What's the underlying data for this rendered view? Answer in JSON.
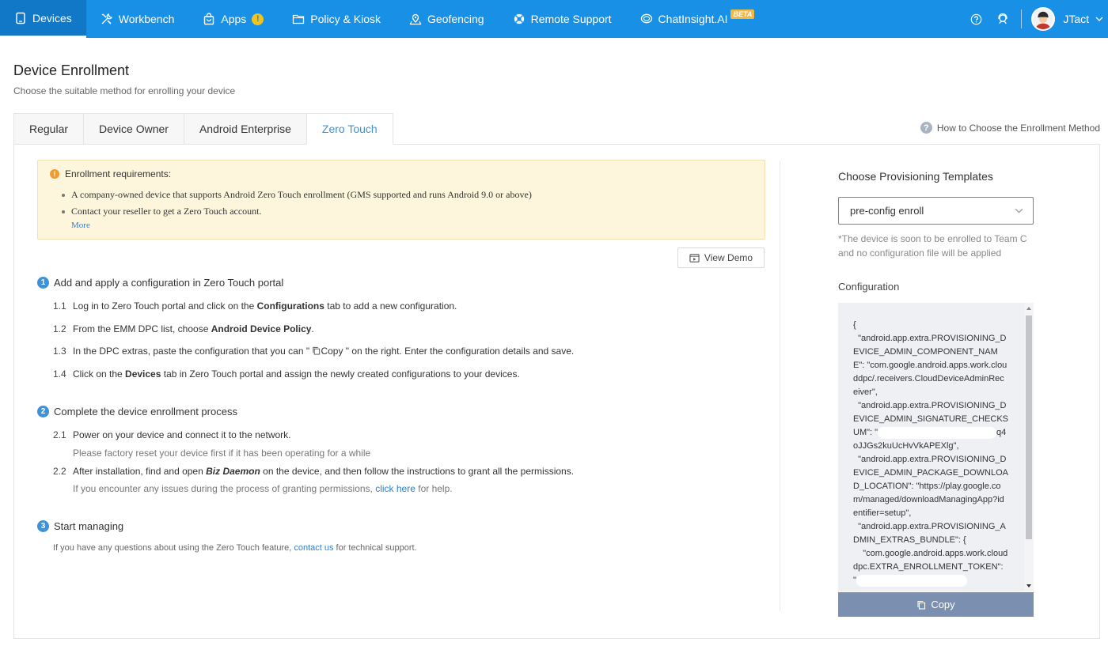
{
  "nav": {
    "items": [
      {
        "label": "Devices",
        "icon": "tablet-icon",
        "active": true
      },
      {
        "label": "Workbench",
        "icon": "tools-icon"
      },
      {
        "label": "Apps",
        "icon": "bag-icon",
        "badge": "!"
      },
      {
        "label": "Policy & Kiosk",
        "icon": "folder-icon"
      },
      {
        "label": "Geofencing",
        "icon": "map-pin-icon"
      },
      {
        "label": "Remote Support",
        "icon": "lifebuoy-icon"
      },
      {
        "label": "ChatInsight.AI",
        "icon": "chat-bubble-icon",
        "tag": "BETA"
      }
    ],
    "user": "JTact"
  },
  "header": {
    "title": "Device Enrollment",
    "subtitle": "Choose the suitable method for enrolling your device"
  },
  "tabs": [
    "Regular",
    "Device Owner",
    "Android Enterprise",
    "Zero Touch"
  ],
  "active_tab": "Zero Touch",
  "help_link": "How to Choose the Enrollment Method",
  "notice": {
    "title": "Enrollment requirements:",
    "items": [
      "A company-owned device that supports Android Zero Touch enrollment (GMS supported and runs Android 9.0 or above)",
      "Contact your reseller to get a Zero Touch account."
    ],
    "more": "More"
  },
  "view_demo": "View Demo",
  "steps": {
    "s1": {
      "num": "1",
      "title": "Add and apply a configuration in Zero Touch portal",
      "sub": {
        "a": {
          "num": "1.1",
          "pre": "Log in to Zero Touch portal and click on the ",
          "bold": "Configurations",
          "post": " tab to add a new configuration."
        },
        "b": {
          "num": "1.2",
          "pre": "From the EMM DPC list, choose ",
          "bold": "Android Device Policy",
          "post": "."
        },
        "c": {
          "num": "1.3",
          "pre": "In the DPC extras, paste the configuration that you can \" ",
          "copy": "Copy",
          "post": " \" on the right. Enter the configuration details and save."
        },
        "d": {
          "num": "1.4",
          "pre": "Click on the ",
          "bold": "Devices",
          "post": " tab in Zero Touch portal and assign the newly created configurations to your devices."
        }
      }
    },
    "s2": {
      "num": "2",
      "title": "Complete the device enrollment process",
      "sub": {
        "a": {
          "num": "2.1",
          "text": "Power on your device and connect it to the network.",
          "note": "Please factory reset your device first if it has been operating for a while"
        },
        "b": {
          "num": "2.2",
          "pre": "After installation, find and open ",
          "bold": "Biz Daemon",
          "post": " on the device, and then follow the instructions to grant all the permissions.",
          "note_pre": "If you encounter any issues during the process of granting permissions, ",
          "note_link": "click here",
          "note_post": " for help."
        }
      }
    },
    "s3": {
      "num": "3",
      "title": "Start managing",
      "note_pre": "If you have any questions about using the Zero Touch feature, ",
      "note_link": "contact us",
      "note_post": " for technical support."
    }
  },
  "right": {
    "title": "Choose Provisioning Templates",
    "select_value": "pre-config enroll",
    "note_line1": "*The device is soon to be enrolled to Team C",
    "note_line2": "and no configuration file will be applied",
    "config_label": "Configuration",
    "config_l1": "{\n  \"android.app.extra.PROVISIONING_DEVICE_ADMIN_COMPONENT_NAME\": \"com.google.android.apps.work.clouddpc/.receivers.CloudDeviceAdminReceiver\",\n  \"android.app.extra.PROVISIONING_DEVICE_ADMIN_SIGNATURE_CHECKSUM\": \"",
    "config_l2": "q4oJJGs2kuUcHvVkAPEXlg\",\n  \"android.app.extra.PROVISIONING_DEVICE_ADMIN_PACKAGE_DOWNLOAD_LOCATION\": \"https://play.google.com/managed/downloadManagingApp?identifier=setup\",\n  \"android.app.extra.PROVISIONING_ADMIN_EXTRAS_BUNDLE\": {\n    \"com.google.android.apps.work.clouddpc.EXTRA_ENROLLMENT_TOKEN\": \"",
    "copy_button": "Copy"
  }
}
